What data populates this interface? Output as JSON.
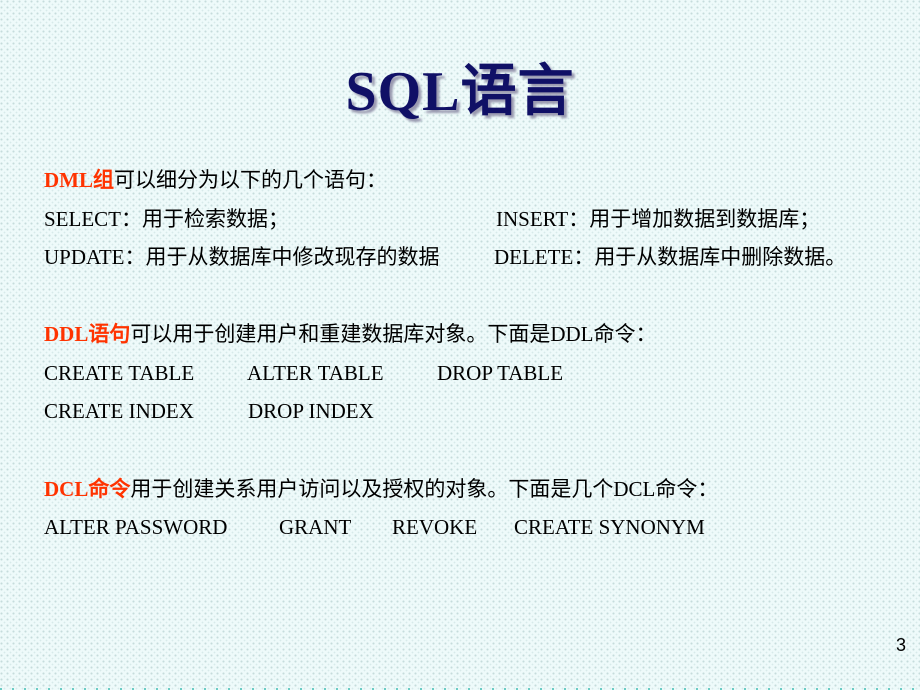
{
  "slide": {
    "title": "SQL语言",
    "page_number": "3",
    "highlight_color": "#ff3300",
    "title_color": "#101066"
  },
  "dml": {
    "label": "DML组",
    "intro": "可以细分为以下的几个语句：",
    "rows": [
      [
        {
          "cmd": "SELECT",
          "sep": "：",
          "desc": "用于检索数据；"
        },
        {
          "cmd": "INSERT",
          "sep": "：",
          "desc": "用于增加数据到数据库；"
        }
      ],
      [
        {
          "cmd": "UPDATE",
          "sep": "：",
          "desc": "用于从数据库中修改现存的数据"
        },
        {
          "cmd": "DELETE",
          "sep": "：",
          "desc": "用于从数据库中删除数据。"
        }
      ]
    ]
  },
  "ddl": {
    "label": "DDL语句",
    "intro": "可以用于创建用户和重建数据库对象。下面是DDL命令：",
    "rows": [
      [
        "CREATE TABLE",
        "ALTER TABLE",
        "DROP TABLE"
      ],
      [
        "CREATE INDEX",
        "DROP INDEX"
      ]
    ]
  },
  "dcl": {
    "label": "DCL命令",
    "intro": "用于创建关系用户访问以及授权的对象。下面是几个DCL命令：",
    "commands": [
      "ALTER PASSWORD",
      "GRANT",
      "REVOKE",
      "CREATE SYNONYM"
    ]
  }
}
